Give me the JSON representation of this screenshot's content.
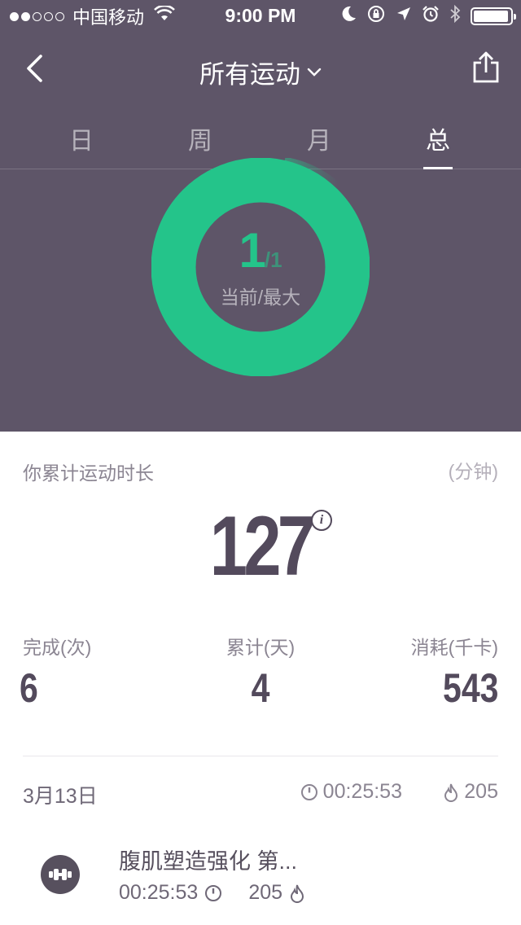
{
  "status_bar": {
    "carrier": "中国移动",
    "time": "9:00 PM",
    "signal_dots_filled": 2,
    "signal_dots_total": 5,
    "battery_level": 0.9
  },
  "nav": {
    "title": "所有运动",
    "back_icon": "chevron-left-icon",
    "share_icon": "share-icon"
  },
  "tabs": [
    {
      "label": "日",
      "active": false
    },
    {
      "label": "周",
      "active": false
    },
    {
      "label": "月",
      "active": false
    },
    {
      "label": "总",
      "active": true
    }
  ],
  "ring": {
    "current": "1",
    "max": "/1",
    "label": "当前/最大",
    "progress": 1.0,
    "color": "#24c48a"
  },
  "duration": {
    "label": "你累计运动时长",
    "unit": "(分钟)",
    "value": "127"
  },
  "stats": [
    {
      "label": "完成(次)",
      "value": "6"
    },
    {
      "label": "累计(天)",
      "value": "4"
    },
    {
      "label": "消耗(千卡)",
      "value": "543"
    }
  ],
  "records": {
    "date": "3月13日",
    "total_time": "00:25:53",
    "total_calories": "205",
    "items": [
      {
        "title": "腹肌塑造强化  第...",
        "time": "00:25:53",
        "calories": "205"
      }
    ]
  },
  "colors": {
    "header_bg": "#5e5568",
    "accent": "#24c48a",
    "text_dark": "#534a5c"
  }
}
